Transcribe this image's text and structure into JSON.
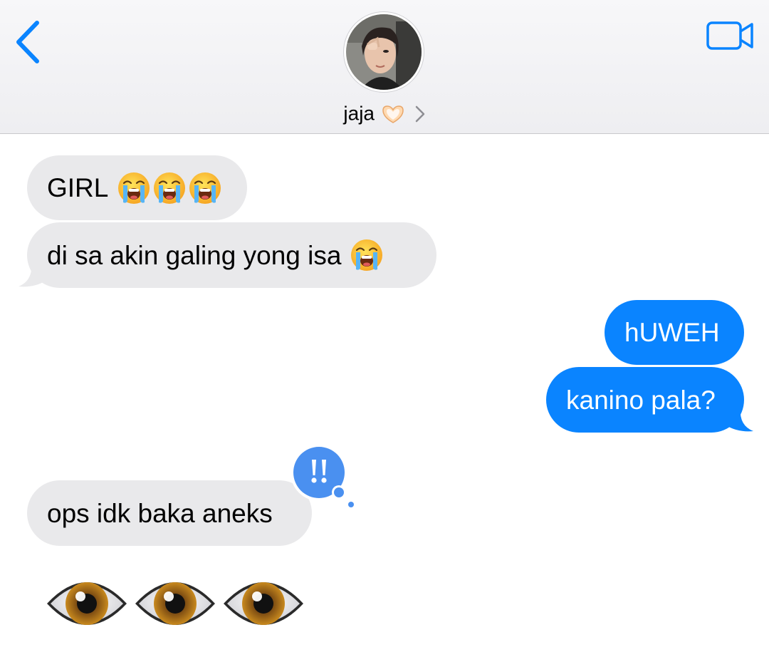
{
  "header": {
    "contact_name": "jaja",
    "contact_emoji": "heart-hands-emoji",
    "back_icon": "chevron-left-icon",
    "video_icon": "video-camera-icon",
    "disclosure_icon": "chevron-right-icon",
    "accent_color": "#0a84ff"
  },
  "messages": [
    {
      "side": "received",
      "text": "GIRL",
      "emoji": [
        "loudly-crying-face",
        "loudly-crying-face",
        "loudly-crying-face"
      ]
    },
    {
      "side": "received",
      "text": "di sa akin galing yong isa",
      "emoji": [
        "loudly-crying-face"
      ]
    },
    {
      "side": "sent",
      "text": "hUWEH"
    },
    {
      "side": "sent",
      "text": "kanino pala?"
    },
    {
      "side": "received",
      "text": "ops idk baka aneks",
      "tapback": "exclamation-marks"
    },
    {
      "side": "received",
      "emoji_only": [
        "eye",
        "eye",
        "eye"
      ]
    }
  ],
  "colors": {
    "received_bubble": "#e9e9eb",
    "sent_bubble": "#0a84ff",
    "tapback_bubble": "#4a90f0"
  }
}
